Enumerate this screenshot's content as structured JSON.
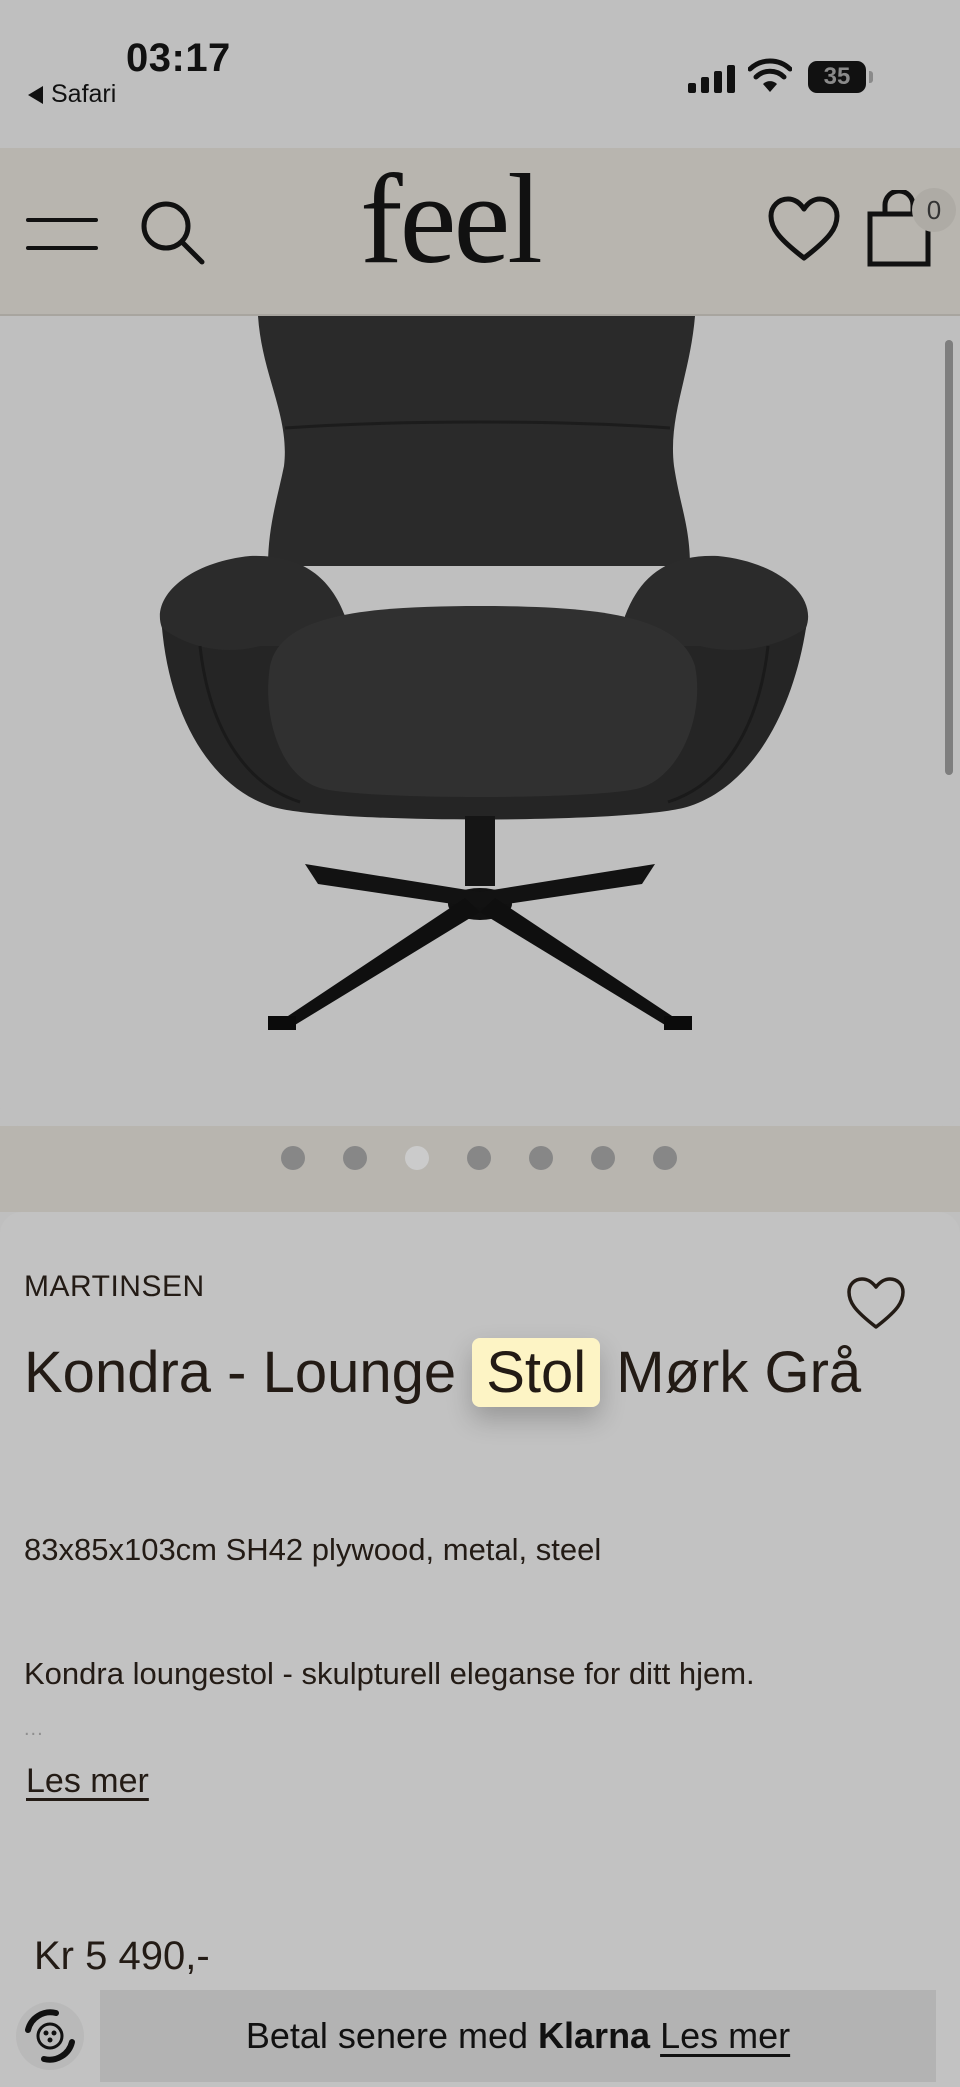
{
  "status_bar": {
    "time": "03:17",
    "back_app": "Safari",
    "battery": "35"
  },
  "header": {
    "logo": "feel",
    "cart_count": "0"
  },
  "gallery": {
    "dot_count": 7,
    "active_index": 2
  },
  "product": {
    "brand": "MARTINSEN",
    "title_before": "Kondra - Lounge ",
    "title_highlight": "Stol",
    "title_after": " Mørk Grå",
    "dimensions": "83x85x103cm SH42 plywood, metal, steel",
    "description": "Kondra loungestol - skulpturell eleganse for ditt hjem.",
    "ellipsis": "...",
    "read_more": "Les mer",
    "price": "Kr 5 490,-"
  },
  "klarna": {
    "prefix": "Betal senere med",
    "brand": "Klarna",
    "link": "Les mer"
  },
  "colors": {
    "page_bg": "#bfbfbf",
    "header_bg": "#b8b5af",
    "text": "#231b15",
    "highlight": "#fdf4c5"
  }
}
